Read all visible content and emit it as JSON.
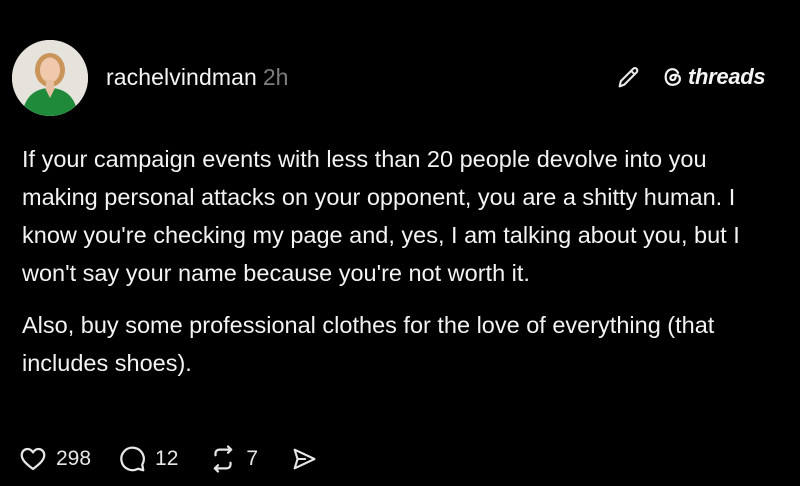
{
  "post": {
    "author": {
      "username": "rachelvindman",
      "timestamp": "2h"
    },
    "brand": {
      "label": "threads"
    },
    "body": {
      "paragraph_1": "If your campaign events with less than 20 people devolve into you making personal attacks on your opponent, you are a shitty human. I know you're checking my page and, yes, I am talking about you, but I won't say your name because you're not worth it.",
      "paragraph_2": "Also, buy some professional clothes for the love of everything (that includes shoes)."
    },
    "actions": {
      "likes": "298",
      "comments": "12",
      "reposts": "7"
    }
  },
  "colors": {
    "background": "#000000",
    "text": "#f3f3f3",
    "muted": "#7d7d7d",
    "avatar_outfit": "#1e8a3a"
  },
  "icons": [
    "pencil-icon",
    "threads-logo-icon",
    "heart-icon",
    "comment-icon",
    "repost-icon",
    "share-icon"
  ]
}
